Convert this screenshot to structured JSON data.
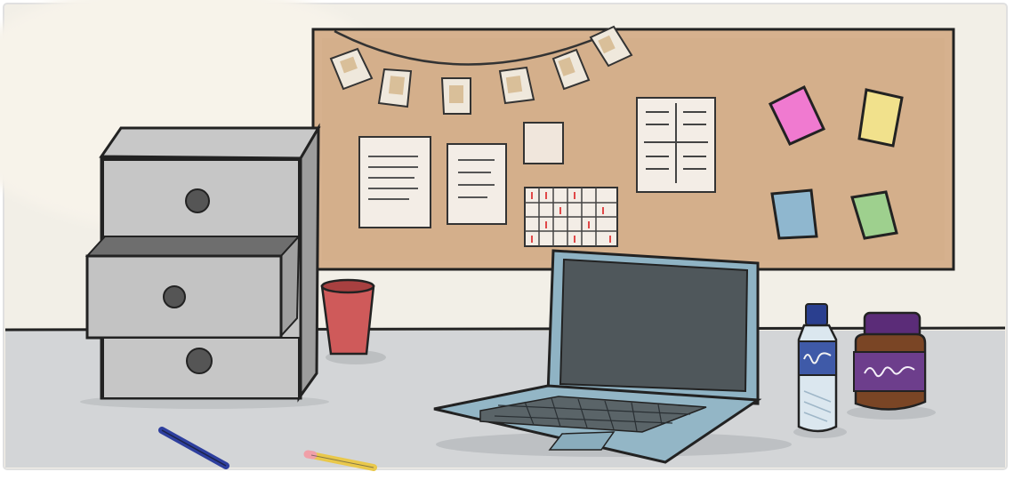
{
  "scene": {
    "description_visible_text": "",
    "objects": {
      "drawer_cabinet": {
        "drawers": 3,
        "open_drawer": "middle",
        "color": "#c4c4c4"
      },
      "corkboard": {
        "color": "#d4b08c",
        "bunting_flags": 6
      },
      "sticky_notes": [
        {
          "color": "#f07ad0"
        },
        {
          "color": "#f0e08a"
        },
        {
          "color": "#8fb7cf"
        },
        {
          "color": "#98cf8a"
        }
      ],
      "cup": {
        "color": "#cf5a5a"
      },
      "laptop": {
        "body_color": "#8fb3c4",
        "screen_color": "#4d5559"
      },
      "water_bottle": {
        "cap_color": "#2a3f8f",
        "label_color": "#3f5aa8"
      },
      "jar": {
        "lid_color": "#5b2c78",
        "body_color": "#7a4525",
        "label_color": "#6d3e8c"
      },
      "pen": {
        "color": "#2e3f9e"
      },
      "pencil": {
        "color": "#e9c84a"
      }
    },
    "colors": {
      "wall": "#f2efe7",
      "desk": "#d2d4d6",
      "outline": "#222222"
    }
  }
}
